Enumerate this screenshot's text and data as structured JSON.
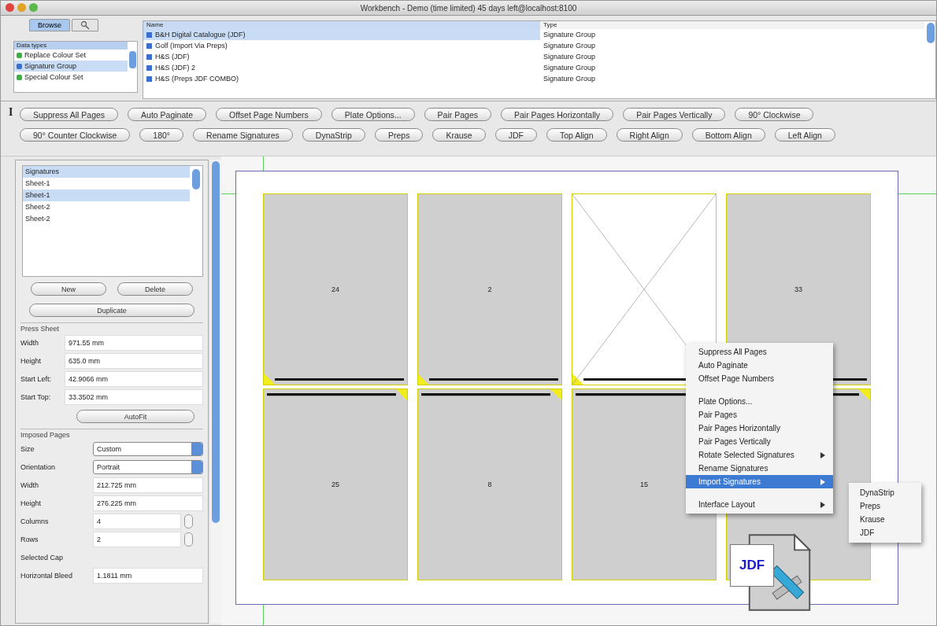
{
  "window": {
    "title": "Workbench - Demo (time limited) 45 days left@localhost:8100"
  },
  "browser_tabs": [
    {
      "kind": "text",
      "label": "Browse",
      "selected": true
    },
    {
      "kind": "icon",
      "selected": false
    }
  ],
  "data_types": {
    "header": "Data types",
    "items": [
      {
        "label": "Replace Colour Set",
        "color": "#3cb043",
        "selected": false
      },
      {
        "label": "Signature Group",
        "color": "#3a6fd0",
        "selected": true
      },
      {
        "label": "Special Colour Set",
        "color": "#3cb043",
        "selected": false
      }
    ]
  },
  "items_table": {
    "columns": [
      "Name",
      "Type"
    ],
    "rows": [
      {
        "name": "B&H Digital Catalogue (JDF)",
        "type": "Signature Group",
        "selected": true
      },
      {
        "name": "Golf (Import Via Preps)",
        "type": "Signature Group",
        "selected": false
      },
      {
        "name": "H&S (JDF)",
        "type": "Signature Group",
        "selected": false
      },
      {
        "name": "H&S (JDF) 2",
        "type": "Signature Group",
        "selected": false
      },
      {
        "name": "H&S (Preps JDF COMBO)",
        "type": "Signature Group",
        "selected": false
      }
    ]
  },
  "toolbar": {
    "marker": "I",
    "buttons": [
      "Suppress All Pages",
      "Auto Paginate",
      "Offset Page Numbers",
      "Plate Options...",
      "Pair Pages",
      "Pair Pages Horizontally",
      "Pair Pages Vertically",
      "90° Clockwise",
      "90° Counter Clockwise",
      "180°",
      "Rename Signatures",
      "DynaStrip",
      "Preps",
      "Krause",
      "JDF",
      "Top Align",
      "Right Align",
      "Bottom Align",
      "Left Align"
    ]
  },
  "signatures": {
    "items": [
      {
        "label": "Signatures",
        "selected": true
      },
      {
        "label": "Sheet-1",
        "selected": false
      },
      {
        "label": "Sheet-1",
        "selected": true
      },
      {
        "label": "Sheet-2",
        "selected": false
      },
      {
        "label": "Sheet-2",
        "selected": false
      }
    ],
    "buttons": [
      "New",
      "Delete"
    ],
    "wide_button": "Duplicate"
  },
  "press_sheet": {
    "title": "Press Sheet",
    "fields": [
      {
        "label": "Width",
        "value": "971.55 mm"
      },
      {
        "label": "Height",
        "value": "635.0 mm"
      },
      {
        "label": "Start Left:",
        "value": "42.9066 mm"
      },
      {
        "label": "Start Top:",
        "value": "33.3502 mm"
      }
    ],
    "button": "AutoFit"
  },
  "imposed_pages": {
    "title": "Imposed Pages",
    "fields": [
      {
        "kind": "select",
        "label": "Size",
        "value": "Custom"
      },
      {
        "kind": "select",
        "label": "Orientation",
        "value": "Portrait"
      },
      {
        "kind": "text",
        "label": "Width",
        "value": "212.725 mm"
      },
      {
        "kind": "text",
        "label": "Height",
        "value": "276.225 mm"
      },
      {
        "kind": "stepper",
        "label": "Columns",
        "value": "4"
      },
      {
        "kind": "stepper",
        "label": "Rows",
        "value": "2"
      },
      {
        "kind": "empty",
        "label": "Selected Cap"
      },
      {
        "kind": "text",
        "label": "Horizontal Bleed",
        "value": "1.1811 mm"
      }
    ]
  },
  "pages": [
    {
      "kind": "page",
      "number": "24",
      "rotated": false
    },
    {
      "kind": "page",
      "number": "2",
      "rotated": false
    },
    {
      "kind": "blank",
      "rotated": false
    },
    {
      "kind": "page",
      "number": "33",
      "rotated": false
    },
    {
      "kind": "page",
      "number": "25",
      "rotated": true
    },
    {
      "kind": "page",
      "number": "8",
      "rotated": true
    },
    {
      "kind": "page",
      "number": "15",
      "rotated": true
    },
    {
      "kind": "page",
      "rotated": true
    }
  ],
  "context_menu": {
    "items": [
      {
        "kind": "item",
        "label": "Suppress All Pages",
        "selected": false
      },
      {
        "kind": "item",
        "label": "Auto Paginate",
        "selected": false
      },
      {
        "kind": "item",
        "label": "Offset Page Numbers",
        "selected": false
      },
      {
        "kind": "separator"
      },
      {
        "kind": "item",
        "label": "Plate Options...",
        "selected": false
      },
      {
        "kind": "item",
        "label": "Pair Pages",
        "selected": false
      },
      {
        "kind": "item",
        "label": "Pair Pages Horizontally",
        "selected": false
      },
      {
        "kind": "item",
        "label": "Pair Pages Vertically",
        "selected": false
      },
      {
        "kind": "submenu",
        "label": "Rotate Selected Signatures",
        "selected": false
      },
      {
        "kind": "item",
        "label": "Rename Signatures",
        "selected": false
      },
      {
        "kind": "submenu",
        "label": "Import Signatures",
        "selected": true
      },
      {
        "kind": "separator"
      },
      {
        "kind": "submenu",
        "label": "Interface Layout",
        "selected": false
      }
    ]
  },
  "submenu": {
    "items": [
      "DynaStrip",
      "Preps",
      "Krause",
      "JDF"
    ]
  },
  "jdf_icon": {
    "label": "JDF"
  }
}
